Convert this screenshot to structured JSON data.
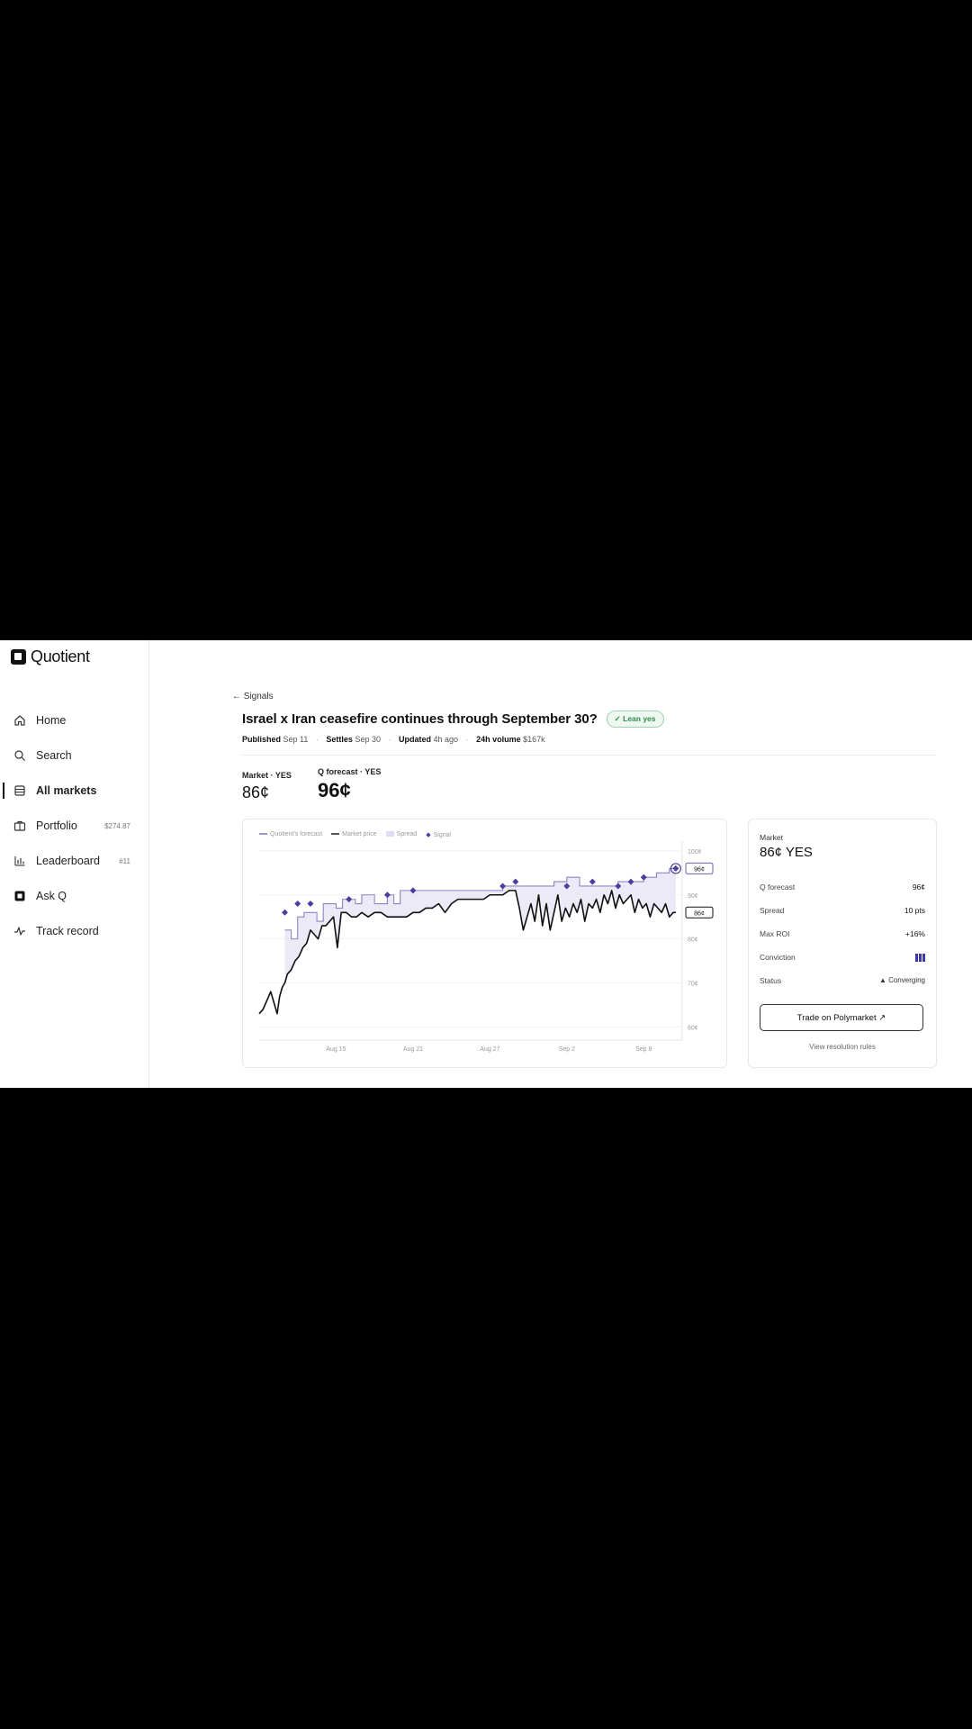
{
  "brand": {
    "name": "Quotient"
  },
  "sidebar": {
    "items": [
      {
        "label": "Home",
        "icon": "home-icon",
        "meta": ""
      },
      {
        "label": "Search",
        "icon": "search-icon",
        "meta": ""
      },
      {
        "label": "All markets",
        "icon": "list-icon",
        "meta": "",
        "active": true
      },
      {
        "label": "Portfolio",
        "icon": "briefcase-icon",
        "meta": "$274.87"
      },
      {
        "label": "Leaderboard",
        "icon": "bar-chart-icon",
        "meta": "#11"
      },
      {
        "label": "Ask Q",
        "icon": "q-logo-icon",
        "meta": ""
      },
      {
        "label": "Track record",
        "icon": "activity-icon",
        "meta": ""
      }
    ]
  },
  "page": {
    "back_label": "← Signals",
    "title": "Israel x Iran ceasefire continues through September 30?",
    "badge": "✓ Lean yes",
    "meta": {
      "published_label": "Published",
      "published_value": "Sep 11",
      "settles_label": "Settles",
      "settles_value": "Sep 30",
      "updated_label": "Updated",
      "updated_value": "4h ago",
      "volume_label": "24h volume",
      "volume_value": "$167k"
    },
    "stats": {
      "market_label": "Market · YES",
      "market_value": "86¢",
      "forecast_label": "Q forecast · YES",
      "forecast_value": "96¢"
    }
  },
  "side_panel": {
    "market_label": "Market",
    "market_value": "86¢ YES",
    "rows": [
      {
        "key": "Q forecast",
        "value": "96¢"
      },
      {
        "key": "Spread",
        "value": "10 pts"
      },
      {
        "key": "Max ROI",
        "value": "+16%"
      },
      {
        "key": "Conviction",
        "value": ""
      },
      {
        "key": "Status",
        "value": "▲ Converging"
      }
    ],
    "conviction_level": 3,
    "trade_button": "Trade on Polymarket ↗",
    "rules_link": "View resolution rules"
  },
  "colors": {
    "forecast": "#5b4fa8",
    "market": "#111111",
    "spread": "#e9e6f6",
    "signal": "#4a3f9c",
    "success": "#2f8a4c"
  },
  "chart_data": {
    "type": "line",
    "legend": [
      "Quotient's forecast",
      "Market price",
      "Spread",
      "Signal"
    ],
    "x_tick_labels": [
      "Aug 15",
      "Aug 21",
      "Aug 27",
      "Sep 2",
      "Sep 8"
    ],
    "y_tick_labels": [
      "100¢",
      "90¢",
      "80¢",
      "70¢",
      "60¢"
    ],
    "ylim": [
      57,
      101
    ],
    "xlim": [
      0,
      33
    ],
    "current_forecast_label": "96¢",
    "current_market_label": "86¢",
    "series": [
      {
        "name": "Quotient's forecast",
        "x": [
          2,
          2.5,
          3,
          3.5,
          4,
          4.5,
          5,
          5.5,
          6,
          6.5,
          7,
          7.5,
          8,
          9,
          10,
          10.5,
          11,
          12,
          13,
          14,
          15,
          16,
          17,
          18,
          19,
          20,
          21,
          22,
          23,
          24,
          25,
          26,
          27,
          28,
          29,
          30,
          31,
          32,
          32.5
        ],
        "y": [
          82,
          80,
          85,
          86,
          86,
          84,
          88,
          88,
          87,
          89,
          89,
          88,
          90,
          88,
          90,
          88,
          91,
          91,
          91,
          91,
          91,
          91,
          91,
          91,
          92,
          92,
          92,
          92,
          93,
          94,
          92,
          92,
          92,
          93,
          93,
          94,
          95,
          96,
          96
        ]
      },
      {
        "name": "Market price",
        "x": [
          0,
          0.3,
          0.6,
          0.9,
          1.2,
          1.4,
          1.6,
          1.8,
          2.0,
          2.2,
          2.5,
          2.8,
          3.1,
          3.4,
          3.7,
          4.0,
          4.3,
          4.6,
          4.9,
          5.2,
          5.5,
          5.8,
          6.1,
          6.4,
          6.8,
          7.2,
          7.6,
          8.0,
          8.5,
          9.0,
          9.5,
          10.0,
          10.5,
          11.0,
          11.5,
          12.0,
          12.5,
          13.0,
          13.5,
          14.0,
          14.5,
          15.0,
          15.5,
          16.0,
          16.5,
          17.0,
          17.5,
          18.0,
          18.5,
          19.0,
          19.5,
          20.0,
          20.3,
          20.6,
          20.9,
          21.2,
          21.5,
          21.8,
          22.1,
          22.4,
          22.7,
          23.0,
          23.3,
          23.6,
          23.9,
          24.2,
          24.5,
          24.8,
          25.1,
          25.4,
          25.7,
          26.0,
          26.3,
          26.6,
          26.9,
          27.2,
          27.5,
          27.8,
          28.1,
          28.4,
          28.7,
          29.0,
          29.3,
          29.6,
          29.9,
          30.2,
          30.5,
          30.8,
          31.1,
          31.4,
          31.7,
          32.0,
          32.3,
          32.5
        ],
        "y": [
          63,
          64,
          66,
          68,
          65,
          63,
          67,
          69,
          70,
          72,
          73,
          75,
          76,
          78,
          79,
          82,
          81,
          80,
          83,
          83,
          84,
          85,
          78,
          86,
          86,
          85,
          85,
          86,
          85,
          86,
          86,
          85,
          85,
          85,
          85,
          86,
          86,
          87,
          87,
          88,
          86,
          88,
          89,
          89,
          89,
          89,
          89,
          90,
          90,
          90,
          91,
          91,
          87,
          82,
          85,
          88,
          84,
          90,
          83,
          88,
          82,
          86,
          90,
          84,
          87,
          85,
          88,
          86,
          89,
          84,
          88,
          87,
          89,
          86,
          90,
          88,
          91,
          87,
          90,
          88,
          89,
          90,
          86,
          89,
          87,
          88,
          85,
          88,
          87,
          86,
          88,
          85,
          86,
          86
        ]
      }
    ],
    "signals": {
      "x": [
        2,
        3,
        4,
        7,
        10,
        12,
        19,
        20,
        24,
        26,
        28,
        29,
        30,
        32.5
      ],
      "y": [
        86,
        88,
        88,
        89,
        90,
        91,
        92,
        93,
        92,
        93,
        92,
        93,
        94,
        96
      ]
    }
  }
}
